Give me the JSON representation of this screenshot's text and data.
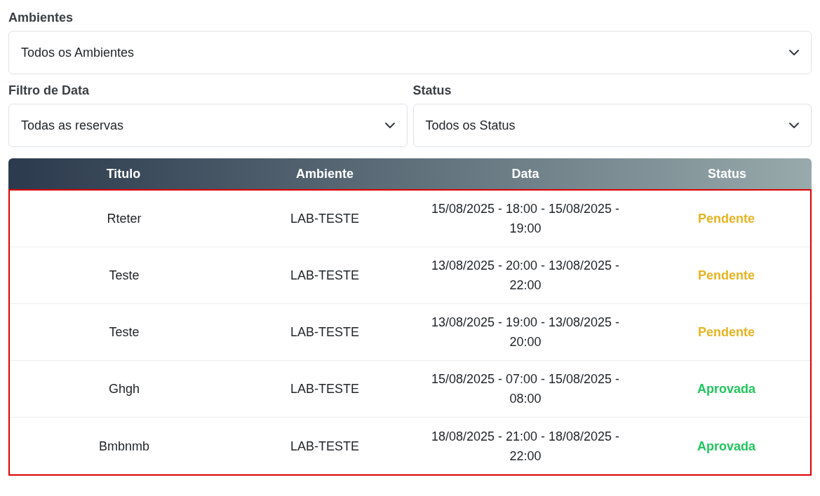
{
  "filters": [
    {
      "label": "Ambientes",
      "value": "Todos os Ambientes"
    },
    {
      "label": "Filtro de Data",
      "value": "Todas as reservas"
    },
    {
      "label": "Status",
      "value": "Todos os Status"
    }
  ],
  "table": {
    "columns": [
      "Titulo",
      "Ambiente",
      "Data",
      "Status"
    ],
    "rows": [
      {
        "titulo": "Rteter",
        "ambiente": "LAB-TESTE",
        "data": "15/08/2025 - 18:00 - 15/08/2025 - 19:00",
        "status": "Pendente",
        "kind": "pending"
      },
      {
        "titulo": "Teste",
        "ambiente": "LAB-TESTE",
        "data": "13/08/2025 - 20:00 - 13/08/2025 - 22:00",
        "status": "Pendente",
        "kind": "pending"
      },
      {
        "titulo": "Teste",
        "ambiente": "LAB-TESTE",
        "data": "13/08/2025 - 19:00 - 13/08/2025 - 20:00",
        "status": "Pendente",
        "kind": "pending"
      },
      {
        "titulo": "Ghgh",
        "ambiente": "LAB-TESTE",
        "data": "15/08/2025 - 07:00 - 15/08/2025 - 08:00",
        "status": "Aprovada",
        "kind": "approved"
      },
      {
        "titulo": "Bmbnmb",
        "ambiente": "LAB-TESTE",
        "data": "18/08/2025 - 21:00 - 18/08/2025 - 22:00",
        "status": "Aprovada",
        "kind": "approved"
      }
    ]
  }
}
